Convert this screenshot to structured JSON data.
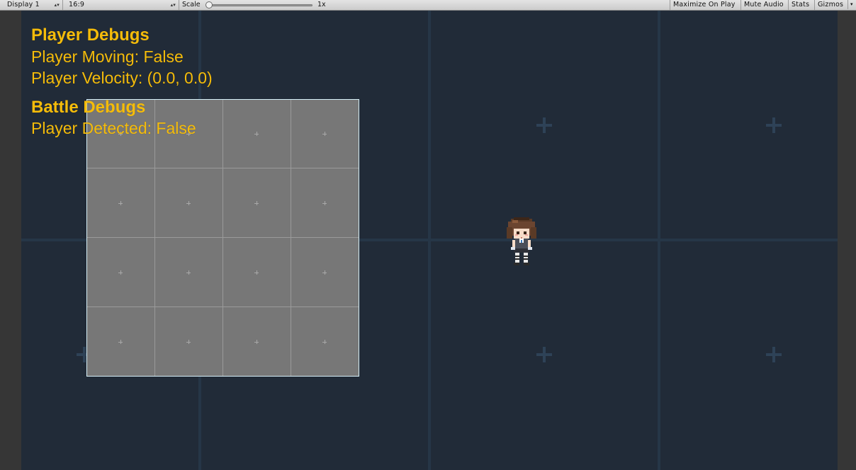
{
  "toolbar": {
    "display_select": "Display 1",
    "aspect_select": "16:9",
    "scale_label": "Scale",
    "scale_value": "1x",
    "maximize_on_play": "Maximize On Play",
    "mute_audio": "Mute Audio",
    "stats": "Stats",
    "gizmos": "Gizmos"
  },
  "debug": {
    "player_header": "Player Debugs",
    "player_moving": "Player Moving: False",
    "player_velocity": "Player Velocity: (0.0, 0.0)",
    "battle_header": "Battle Debugs",
    "player_detected": "Player Detected: False"
  },
  "colors": {
    "debug_text": "#f5bc0a",
    "viewport_bg": "#212b38",
    "grid_line": "#263647",
    "tile_fill": "#777777",
    "tile_border": "#d6f0f8"
  },
  "icons": {
    "dropdown_arrow": "updown-arrow-icon",
    "grid_marker": "plus-icon",
    "character": "character-sprite"
  }
}
